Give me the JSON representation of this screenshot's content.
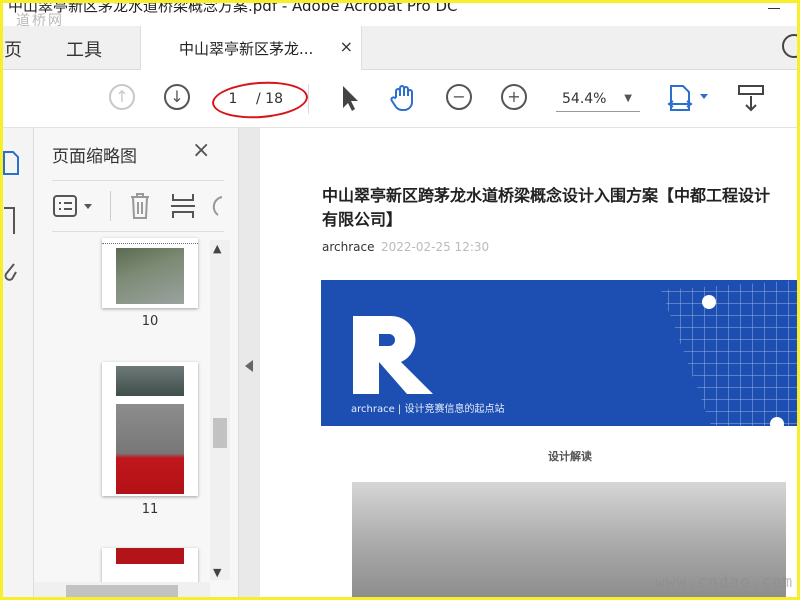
{
  "window": {
    "title": "中山翠亭新区茅龙水道桥梁概念方案.pdf - Adobe Acrobat Pro DC",
    "watermark_top": "道桥网"
  },
  "tabs": {
    "home": "主页",
    "tools": "工具",
    "doc": "中山翠亭新区茅龙...",
    "close": "×"
  },
  "toolbar": {
    "page_current": "1",
    "page_total": "/ 18",
    "zoom": "54.4%"
  },
  "panel": {
    "title": "页面缩略图",
    "close": "×",
    "thumbnails": [
      {
        "label": "10"
      },
      {
        "label": "11"
      }
    ]
  },
  "document": {
    "title_line1": "中山翠亭新区跨茅龙水道桥梁概念设计入围方案【中都工程设计",
    "title_line2": "有限公司】",
    "author": "archrace",
    "datetime": "2022-02-25 12:30",
    "banner_tagline": "archrace | 设计竞赛信息的起点站",
    "section_label": "设计解读",
    "watermark_bottom": "www.cndao.com"
  },
  "colors": {
    "banner_blue": "#1d4fb3",
    "highlight_circle": "#d8141b",
    "frame": "#f7ee2c",
    "accent_blue": "#2d6fcf"
  }
}
